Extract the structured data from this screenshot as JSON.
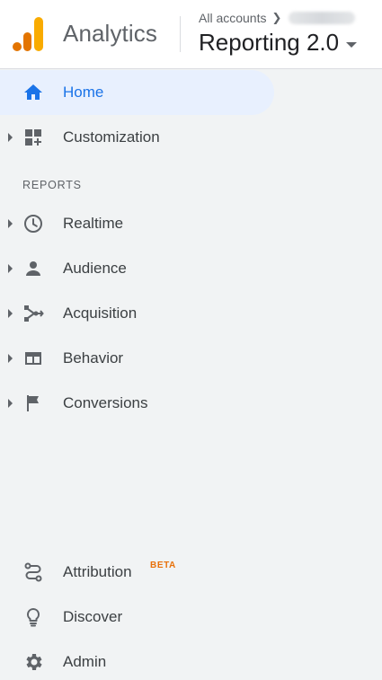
{
  "header": {
    "product_name": "Analytics",
    "breadcrumb_root": "All accounts",
    "view_name": "Reporting 2.0"
  },
  "nav": {
    "home": "Home",
    "customization": "Customization",
    "reports_heading": "REPORTS",
    "realtime": "Realtime",
    "audience": "Audience",
    "acquisition": "Acquisition",
    "behavior": "Behavior",
    "conversions": "Conversions",
    "attribution": "Attribution",
    "attribution_badge": "BETA",
    "discover": "Discover",
    "admin": "Admin"
  },
  "colors": {
    "accent": "#1a73e8",
    "active_bg": "#e8f0fe",
    "beta": "#e8710a",
    "logo_orange": "#f9ab00",
    "logo_dark_orange": "#e37400",
    "sidebar_bg": "#f1f3f4",
    "icon": "#5f6368"
  },
  "icons": {
    "logo": "analytics-logo-icon",
    "home": "home-icon",
    "customization": "dashboard-add-icon",
    "realtime": "clock-icon",
    "audience": "person-icon",
    "acquisition": "merge-arrows-icon",
    "behavior": "web-window-icon",
    "conversions": "flag-icon",
    "attribution": "route-icon",
    "discover": "lightbulb-icon",
    "admin": "gear-icon"
  }
}
